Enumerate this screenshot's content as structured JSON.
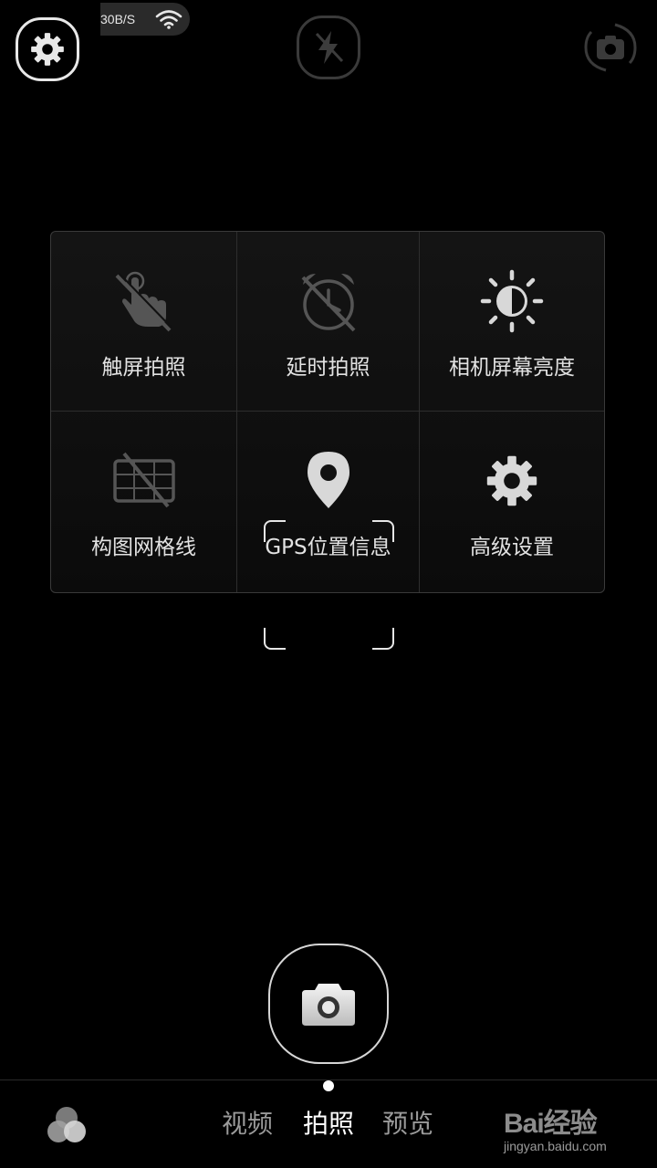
{
  "status": {
    "net_speed": "30B/S"
  },
  "top_bar": {
    "settings_icon": "gear-icon",
    "flash_icon": "flash-off-icon",
    "switch_icon": "camera-switch-icon"
  },
  "settings_panel": {
    "items": [
      {
        "label": "触屏拍照",
        "icon": "touch-shoot-off-icon"
      },
      {
        "label": "延时拍照",
        "icon": "timer-off-icon"
      },
      {
        "label": "相机屏幕亮度",
        "icon": "brightness-icon"
      },
      {
        "label": "构图网格线",
        "icon": "grid-off-icon"
      },
      {
        "label": "GPS位置信息",
        "icon": "location-pin-icon"
      },
      {
        "label": "高级设置",
        "icon": "gear-icon"
      }
    ]
  },
  "mode_bar": {
    "modes": [
      {
        "label": "视频",
        "active": false
      },
      {
        "label": "拍照",
        "active": true
      },
      {
        "label": "预览",
        "active": false
      }
    ]
  },
  "watermark": {
    "main": "Bai经验",
    "sub": "jingyan.baidu.com"
  },
  "colors": {
    "background": "#000000",
    "text": "#e2e2e2",
    "inactive_text": "#9a9a9a"
  }
}
